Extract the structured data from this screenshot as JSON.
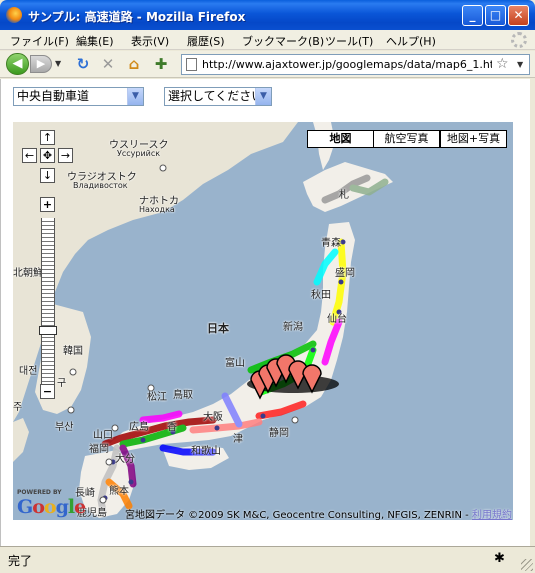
{
  "window": {
    "title": "サンプル: 高速道路 - Mozilla Firefox",
    "controls": {
      "minimize": "_",
      "maximize": "□",
      "close": "✕"
    }
  },
  "menu": {
    "items": [
      "ファイル(F)",
      "編集(E)",
      "表示(V)",
      "履歴(S)",
      "ブックマーク(B)",
      "ツール(T)",
      "ヘルプ(H)"
    ]
  },
  "nav": {
    "back_glyph": "◀",
    "forward_glyph": "▶",
    "url": "http://www.ajaxtower.jp/googlemaps/data/map6_1.ht",
    "star": "☆"
  },
  "page": {
    "road_select": {
      "value": "中央自動車道"
    },
    "section_select": {
      "value": "選択してください"
    }
  },
  "map": {
    "type_buttons": [
      "地図",
      "航空写真",
      "地図+写真"
    ],
    "active_type": "地図",
    "controls": {
      "up": "↑",
      "left": "←",
      "center": "✥",
      "right": "→",
      "down": "↓",
      "zoom_in": "+",
      "zoom_out": "−"
    },
    "labels": {
      "ussuriysk": "ウスリースク",
      "ussuriysk_ru": "Уссурийск",
      "vladivostok": "ウラジオストク",
      "vladivostok_ru": "Владивосток",
      "nakhodka": "ナホトカ",
      "nakhodka_ru": "Находка",
      "north_korea": "北朝鮮",
      "korea": "韓国",
      "daejeon": "대전",
      "busan": "부산",
      "gu": "구",
      "ju": "주",
      "japan": "日本",
      "aomori": "青森",
      "akita": "秋田",
      "niigata": "新潟",
      "toyama": "富山",
      "matsue": "松江",
      "tottori": "鳥取",
      "yamaguchi": "山口",
      "fukuoka": "福岡",
      "oita": "大分",
      "osaka": "大阪",
      "tsu": "津",
      "wakayama": "和歌山",
      "shizuoka": "静岡",
      "kumamoto": "熊本",
      "nagasaki": "長崎",
      "kagoshima": "鹿児島",
      "kagawa": "香",
      "hiroshima": "広島",
      "sendai": "仙台",
      "morioka": "盛岡",
      "sapporo": "札"
    },
    "powered_by": "POWERED BY",
    "logo": "Google",
    "copyright": "地図データ ©2009 SK M&C, Geocentre Consulting, NFGIS, ZENRIN -",
    "copyright_prefix": "宮",
    "terms": "利用規約"
  },
  "status": {
    "text": "完了"
  },
  "colors": {
    "sea": "#99b3cc",
    "land": "#f2efe9",
    "titlebar": "#0a56d8",
    "marker": "#f2766a"
  }
}
